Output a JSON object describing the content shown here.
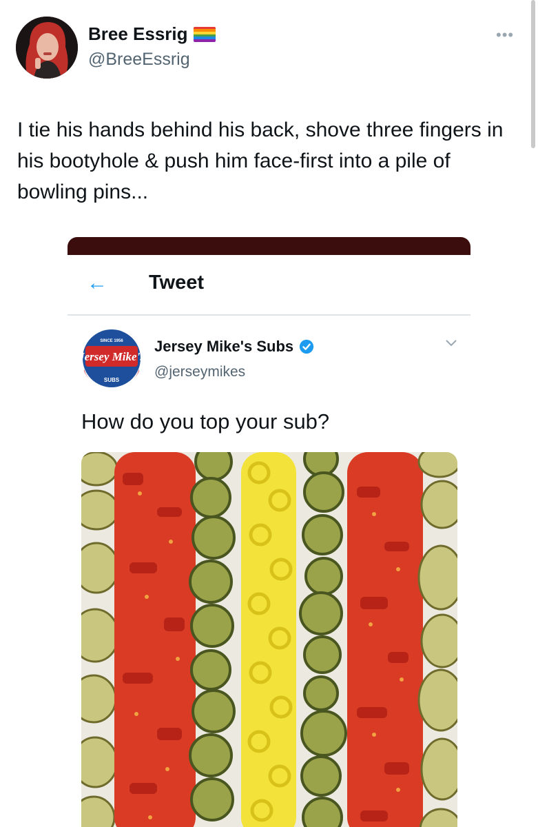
{
  "tweet": {
    "display_name": "Bree Essrig",
    "handle": "@BreeEssrig",
    "more_label": "•••",
    "name_flag_icon": "rainbow-flag-icon",
    "text": "I tie his hands behind his back, shove  three fingers in his bootyhole & push him face-first into a pile of bowling pins..."
  },
  "embed": {
    "back_icon": "←",
    "header_title": "Tweet",
    "account": {
      "display_name": "Jersey Mike's Subs",
      "handle": "@jerseymikes",
      "verified_icon": "verified-badge-icon",
      "logo_icon": "jersey-mikes-logo",
      "logo_text": "Jersey Mike's",
      "logo_since": "SINCE 1956",
      "logo_subs": "SUBS"
    },
    "menu_icon": "chevron-down-icon",
    "text": "How do you top your sub?",
    "media_description_icon": "toppings-photo"
  },
  "colors": {
    "accent": "#1d9bf0",
    "topbar": "#3b0d0d",
    "secondary_text": "#536471"
  }
}
